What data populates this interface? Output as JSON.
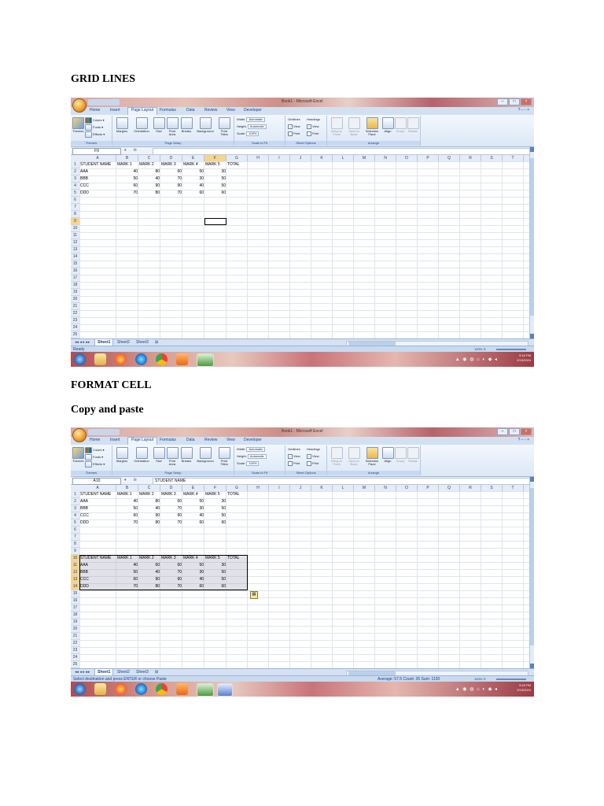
{
  "headings": {
    "grid_lines": "GRID LINES",
    "format_cell": "FORMAT CELL",
    "copy_paste": "Copy and paste"
  },
  "excel": {
    "window_title": "Book1 - Microsoft Excel",
    "window_controls": [
      "–",
      "□",
      "×"
    ],
    "tabs": [
      "Home",
      "Insert",
      "Page Layout",
      "Formulas",
      "Data",
      "Review",
      "View",
      "Developer"
    ],
    "active_tab": "Page Layout",
    "ribbon": {
      "themes_group": "Themes",
      "themes_label": "Themes",
      "colors": "Colors",
      "fonts": "Fonts",
      "effects": "Effects",
      "page_setup_group": "Page Setup",
      "margins": "Margins",
      "orientation": "Orientation",
      "size": "Size",
      "print_area": "Print Area",
      "breaks": "Breaks",
      "background": "Background",
      "print_titles": "Print Titles",
      "scale_group": "Scale to Fit",
      "width_label": "Width:",
      "width_value": "Automatic",
      "height_label": "Height:",
      "height_value": "Automatic",
      "scale_label": "Scale:",
      "scale_value": "100%",
      "sheet_options_group": "Sheet Options",
      "gridlines": "Gridlines",
      "headings": "Headings",
      "view": "View",
      "print": "Print",
      "arrange_group": "Arrange",
      "bring_front": "Bring to Front",
      "send_back": "Send to Back",
      "selection_pane": "Selection Pane",
      "align": "Align",
      "group": "Group",
      "rotate": "Rotate"
    },
    "fx": "fx",
    "columns": [
      "A",
      "B",
      "C",
      "D",
      "E",
      "F",
      "G",
      "H",
      "I",
      "J",
      "K",
      "L",
      "M",
      "N",
      "O",
      "P",
      "Q",
      "R",
      "S",
      "T"
    ],
    "rows": [
      "1",
      "2",
      "3",
      "4",
      "5",
      "6",
      "7",
      "8",
      "9",
      "10",
      "11",
      "12",
      "13",
      "14",
      "15",
      "16",
      "17",
      "18",
      "19",
      "20",
      "21",
      "22",
      "23",
      "24",
      "25"
    ],
    "sheet_tabs": [
      "Sheet1",
      "Sheet2",
      "Sheet3"
    ],
    "taskbar_time": "9:16 PM",
    "taskbar_date": "2/19/2024",
    "zoom": "100%"
  },
  "shot1": {
    "name_box": "F9",
    "formula": "",
    "status_left": "Ready",
    "status_right": "",
    "table": {
      "headers": [
        "STUDENT NAME",
        "MARK 1",
        "MARK 2",
        "MARK 3",
        "MARK 4",
        "MARK 5",
        "TOTAL"
      ],
      "rows": [
        [
          "AAA",
          "40",
          "80",
          "60",
          "50",
          "30",
          ""
        ],
        [
          "BBB",
          "50",
          "40",
          "70",
          "30",
          "50",
          ""
        ],
        [
          "CCC",
          "60",
          "90",
          "90",
          "40",
          "50",
          ""
        ],
        [
          "DDD",
          "70",
          "80",
          "70",
          "60",
          "60",
          ""
        ]
      ]
    }
  },
  "shot2": {
    "name_box": "A10",
    "formula": "STUDENT NAME",
    "status_left": "Select destination and press ENTER or choose Paste",
    "status_right": "Average: 57.5    Count: 35    Sum: 1150",
    "table": {
      "headers": [
        "STUDENT NAME",
        "MARK 1",
        "MARK 2",
        "MARK 3",
        "MARK 4",
        "MARK 5",
        "TOTAL"
      ],
      "rows": [
        [
          "AAA",
          "40",
          "80",
          "60",
          "50",
          "30",
          ""
        ],
        [
          "BBB",
          "50",
          "40",
          "70",
          "30",
          "50",
          ""
        ],
        [
          "CCC",
          "60",
          "90",
          "90",
          "40",
          "50",
          ""
        ],
        [
          "DDD",
          "70",
          "80",
          "70",
          "60",
          "60",
          ""
        ]
      ]
    },
    "pasted": {
      "headers": [
        "STUDENT NAME",
        "MARK 1",
        "MARK 2",
        "MARK 3",
        "MARK 4",
        "MARK 5",
        "TOTAL"
      ],
      "rows": [
        [
          "AAA",
          "40",
          "60",
          "60",
          "50",
          "30",
          ""
        ],
        [
          "BBB",
          "50",
          "40",
          "70",
          "30",
          "50",
          ""
        ],
        [
          "CCC",
          "60",
          "90",
          "90",
          "40",
          "50",
          ""
        ],
        [
          "DDD",
          "70",
          "80",
          "70",
          "60",
          "60",
          ""
        ]
      ]
    }
  }
}
